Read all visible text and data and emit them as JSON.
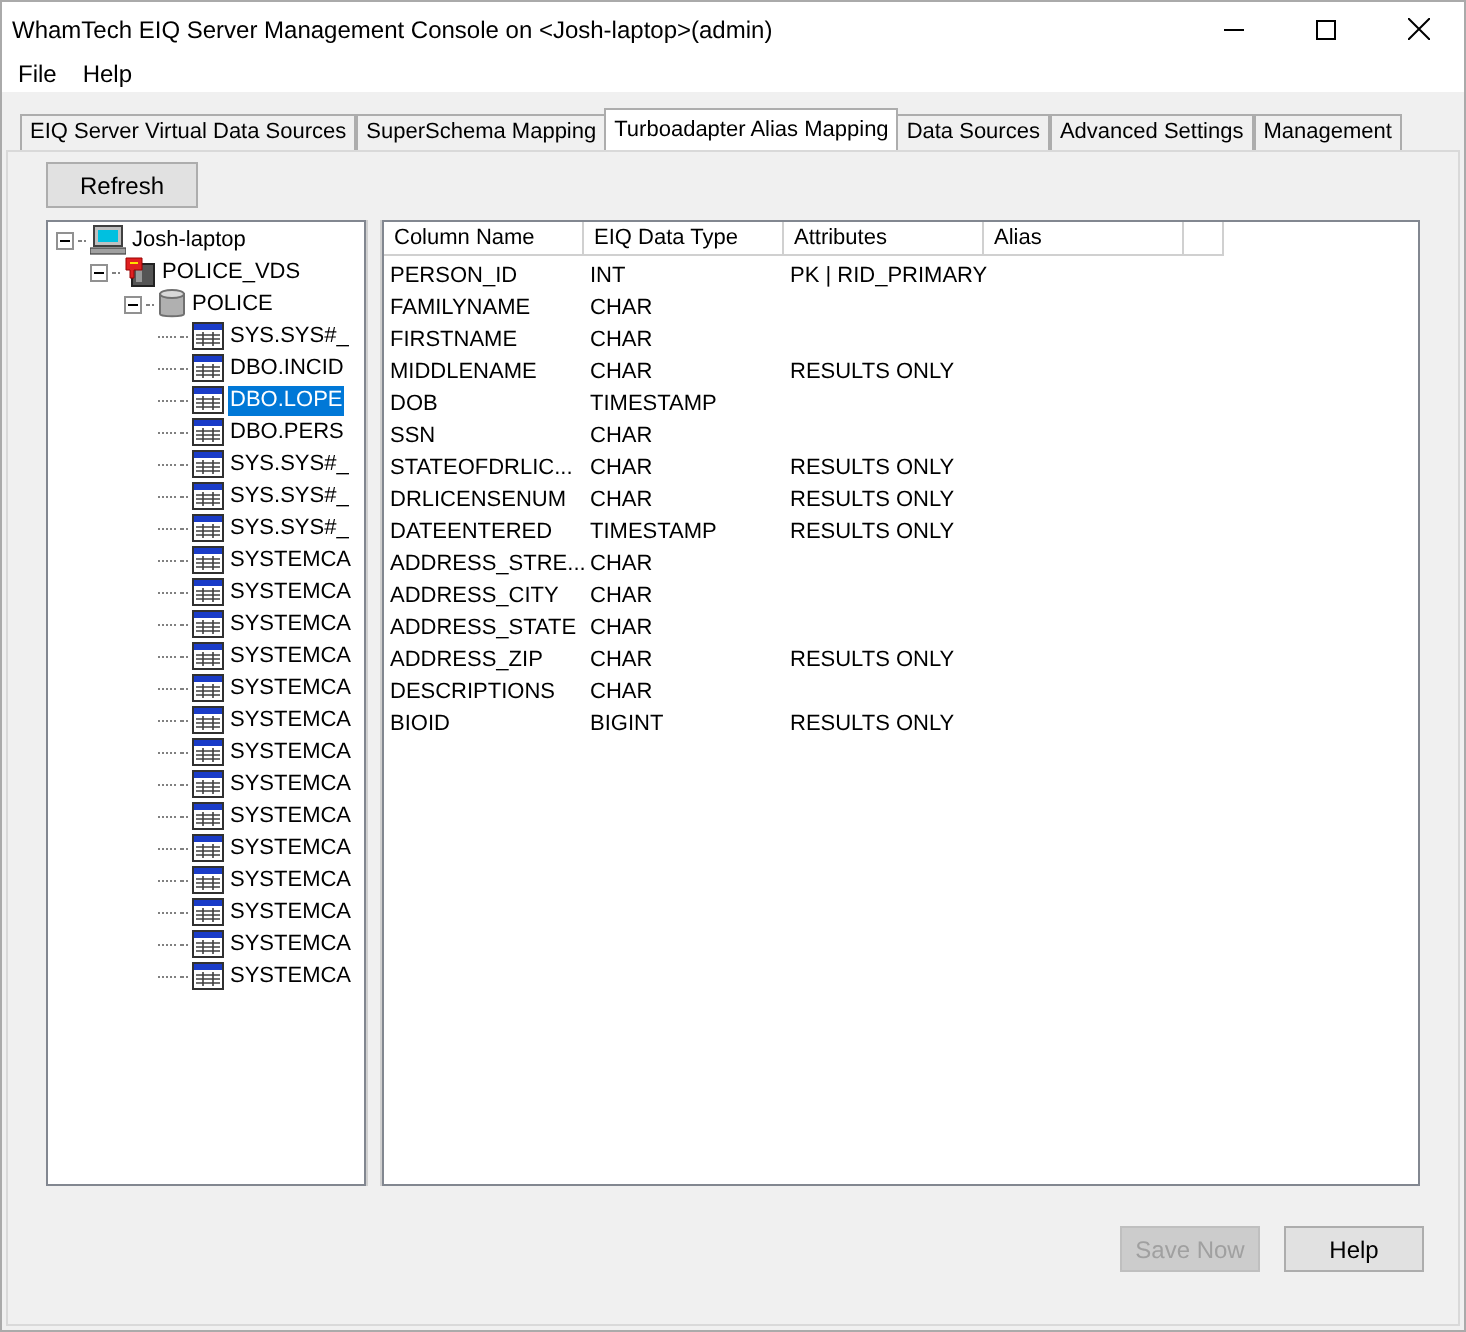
{
  "window": {
    "title": "WhamTech EIQ Server Management Console on <Josh-laptop>(admin)"
  },
  "menu": [
    "File",
    "Help"
  ],
  "tabs": [
    {
      "label": "EIQ Server Virtual Data Sources",
      "selected": false
    },
    {
      "label": "SuperSchema Mapping",
      "selected": false
    },
    {
      "label": "Turboadapter Alias Mapping",
      "selected": true
    },
    {
      "label": "Data Sources",
      "selected": false
    },
    {
      "label": "Advanced Settings",
      "selected": false
    },
    {
      "label": "Management",
      "selected": false
    }
  ],
  "refresh_button": "Refresh",
  "tree": [
    {
      "label": "Josh-laptop",
      "kind": "computer",
      "expanded": true,
      "selected": false,
      "children": [
        {
          "label": "POLICE_VDS",
          "kind": "vds",
          "expanded": true,
          "selected": false,
          "children": [
            {
              "label": "POLICE",
              "kind": "database",
              "expanded": true,
              "selected": false,
              "children": [
                {
                  "label": "SYS.SYS#_",
                  "kind": "table",
                  "selected": false
                },
                {
                  "label": "DBO.INCID",
                  "kind": "table",
                  "selected": false
                },
                {
                  "label": "DBO.LOPE",
                  "kind": "table",
                  "selected": true
                },
                {
                  "label": "DBO.PERS",
                  "kind": "table",
                  "selected": false
                },
                {
                  "label": "SYS.SYS#_",
                  "kind": "table",
                  "selected": false
                },
                {
                  "label": "SYS.SYS#_",
                  "kind": "table",
                  "selected": false
                },
                {
                  "label": "SYS.SYS#_",
                  "kind": "table",
                  "selected": false
                },
                {
                  "label": "SYSTEMCA",
                  "kind": "table",
                  "selected": false
                },
                {
                  "label": "SYSTEMCA",
                  "kind": "table",
                  "selected": false
                },
                {
                  "label": "SYSTEMCA",
                  "kind": "table",
                  "selected": false
                },
                {
                  "label": "SYSTEMCA",
                  "kind": "table",
                  "selected": false
                },
                {
                  "label": "SYSTEMCA",
                  "kind": "table",
                  "selected": false
                },
                {
                  "label": "SYSTEMCA",
                  "kind": "table",
                  "selected": false
                },
                {
                  "label": "SYSTEMCA",
                  "kind": "table",
                  "selected": false
                },
                {
                  "label": "SYSTEMCA",
                  "kind": "table",
                  "selected": false
                },
                {
                  "label": "SYSTEMCA",
                  "kind": "table",
                  "selected": false
                },
                {
                  "label": "SYSTEMCA",
                  "kind": "table",
                  "selected": false
                },
                {
                  "label": "SYSTEMCA",
                  "kind": "table",
                  "selected": false
                },
                {
                  "label": "SYSTEMCA",
                  "kind": "table",
                  "selected": false
                },
                {
                  "label": "SYSTEMCA",
                  "kind": "table",
                  "selected": false
                },
                {
                  "label": "SYSTEMCA",
                  "kind": "table",
                  "selected": false
                }
              ]
            }
          ]
        }
      ]
    }
  ],
  "table": {
    "columns": [
      "Column Name",
      "EIQ Data Type",
      "Attributes",
      "Alias"
    ],
    "rows": [
      [
        "PERSON_ID",
        "INT",
        "PK | RID_PRIMARY"
      ],
      [
        "FAMILYNAME",
        "CHAR",
        ""
      ],
      [
        "FIRSTNAME",
        "CHAR",
        ""
      ],
      [
        "MIDDLENAME",
        "CHAR",
        "RESULTS ONLY"
      ],
      [
        "DOB",
        "TIMESTAMP",
        ""
      ],
      [
        "SSN",
        "CHAR",
        ""
      ],
      [
        "STATEOFDRLIC...",
        "CHAR",
        "RESULTS ONLY"
      ],
      [
        "DRLICENSENUM",
        "CHAR",
        "RESULTS ONLY"
      ],
      [
        "DATEENTERED",
        "TIMESTAMP",
        "RESULTS ONLY"
      ],
      [
        "ADDRESS_STRE...",
        "CHAR",
        ""
      ],
      [
        "ADDRESS_CITY",
        "CHAR",
        ""
      ],
      [
        "ADDRESS_STATE",
        "CHAR",
        ""
      ],
      [
        "ADDRESS_ZIP",
        "CHAR",
        "RESULTS ONLY"
      ],
      [
        "DESCRIPTIONS",
        "CHAR",
        ""
      ],
      [
        "BIOID",
        "BIGINT",
        "RESULTS ONLY"
      ]
    ]
  },
  "buttons": [
    {
      "label": "Save Now",
      "disabled": true
    },
    {
      "label": "Help",
      "disabled": false
    }
  ]
}
